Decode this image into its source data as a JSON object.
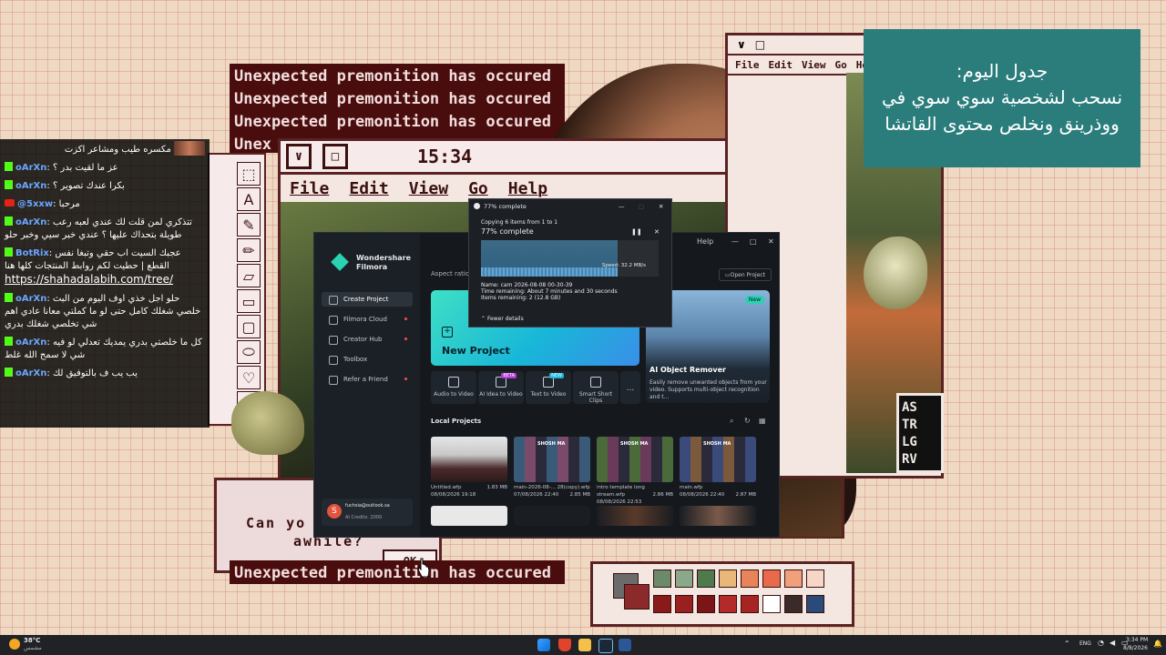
{
  "retro_art": {
    "premonition_lines": [
      "Unexpected premonition has occured",
      "Unexpected premonition has occured",
      "Unexpected premonition has occured",
      "Unex"
    ],
    "premonition_bottom": "Unexpected premonition has occured",
    "window_time": "15:34",
    "menu": [
      "File",
      "Edit",
      "View",
      "Go",
      "Help"
    ],
    "right_menu": [
      "File",
      "Edit",
      "View",
      "Go",
      "Help"
    ],
    "logo_lines": [
      "AS",
      "TR",
      "LG",
      "RV"
    ],
    "dialog_line1": "Can yo",
    "dialog_line2": "awhile?",
    "dialog_ok": "OK",
    "bottom_partial": "Unex"
  },
  "chat": {
    "messages": [
      {
        "platform": "image",
        "user": "",
        "text": "مكسره طيب ومشاعر اكزت"
      },
      {
        "platform": "kick",
        "user": "oArXn",
        "text": "عز ما لقيت بدر ؟"
      },
      {
        "platform": "kick",
        "user": "oArXn",
        "text": "بكرا عندك تصوير ؟"
      },
      {
        "platform": "youtube",
        "user": "@5xxw",
        "text": "مرحبا"
      },
      {
        "platform": "kick",
        "user": "oArXn",
        "text": "تتذكري لمن قلت لك عندي لعبه رعب طويلة بتحداك عليها ؟ عندي خبر سيي وخبر حلو"
      },
      {
        "platform": "kick",
        "user": "BotRix",
        "text": "عجبك السيت اب حقي وتبغا نفس القطع | حطيت لكم روابط المنتجات كلها هنا",
        "link": "https://shahadalabih.com/tree/"
      },
      {
        "platform": "kick",
        "user": "oArXn",
        "text": "حلو اجل خذي اوف اليوم من البث خلصي شغلك كامل حتى لو ما كملتي معانا عادي اهم شي تخلصي شغلك بدري"
      },
      {
        "platform": "kick",
        "user": "oArXn",
        "text": "كل ما خلصتي بدري يمديك تعدلي لو فيه شي لا سمح الله غلط"
      },
      {
        "platform": "kick",
        "user": "oArXn",
        "text": "يب يب ف بالتوفيق لك"
      }
    ]
  },
  "schedule": {
    "title": "جدول اليوم:",
    "line1": "نسحب لشخصية سوي سوي في",
    "line2": "ووذرينق ونخلص محتوى القاتشا"
  },
  "filmora": {
    "brand_line1": "Wondershare",
    "brand_line2": "Filmora",
    "nav": [
      "Create Project",
      "Filmora Cloud",
      "Creator Hub",
      "Toolbox",
      "Refer a Friend"
    ],
    "aspect_label": "Aspect ratio:",
    "help": "Help",
    "open_project": "Open Project",
    "new_project": "New Project",
    "feature_badge": "New",
    "feature_title": "AI Object Remover",
    "feature_desc": "Easily remove unwanted objects from your video. Supports multi-object recognition and t...",
    "tools": [
      {
        "label": "Audio to Video",
        "badge": ""
      },
      {
        "label": "AI Idea to Video",
        "badge": "BETA"
      },
      {
        "label": "Text to Video",
        "badge": "NEW"
      },
      {
        "label": "Smart Short Clips",
        "badge": ""
      }
    ],
    "more_tools": "...",
    "local_projects": "Local Projects",
    "thumb_banner": "SHOSH MA",
    "projects": [
      {
        "name": "Untitled.wfp",
        "date": "08/08/2026 19:18",
        "size": "1.83 MB"
      },
      {
        "name": "main-2026-08-... 28(copy).wfp",
        "date": "07/08/2026 22:40",
        "size": "2.85 MB"
      },
      {
        "name": "intro template long stream.wfp",
        "date": "08/08/2026 22:53",
        "size": "2.86 MB"
      },
      {
        "name": "main.wfp",
        "date": "08/08/2026 22:40",
        "size": "2.87 MB"
      }
    ],
    "user_email": "fuchsia@outlook.sa",
    "user_credits": "AI Credits: 2000",
    "user_initial": "S"
  },
  "copy_dialog": {
    "title": "77% complete",
    "copying": "Copying 6 items from 1 to 1",
    "percent": "77% complete",
    "progress": 0.77,
    "speed": "Speed: 32.2 MB/s",
    "name": "Name: cam 2026-08-08 00-30-39",
    "time": "Time remaining: About 7 minutes and 30 seconds",
    "items": "Items remaining: 2 (12.8 GB)",
    "fewer": "Fewer details"
  },
  "taskbar": {
    "weather_temp": "38°C",
    "weather_desc": "مشمس",
    "lang": "ENG",
    "time": "3:34 PM",
    "date": "8/8/2026"
  },
  "colors": {
    "chat_bg": "#000000",
    "schedule_bg": "#2b7d7c",
    "retro_dark": "#4a0d0d",
    "kick_green": "#53fc18",
    "filmora_accent": "#2ad1b3"
  }
}
